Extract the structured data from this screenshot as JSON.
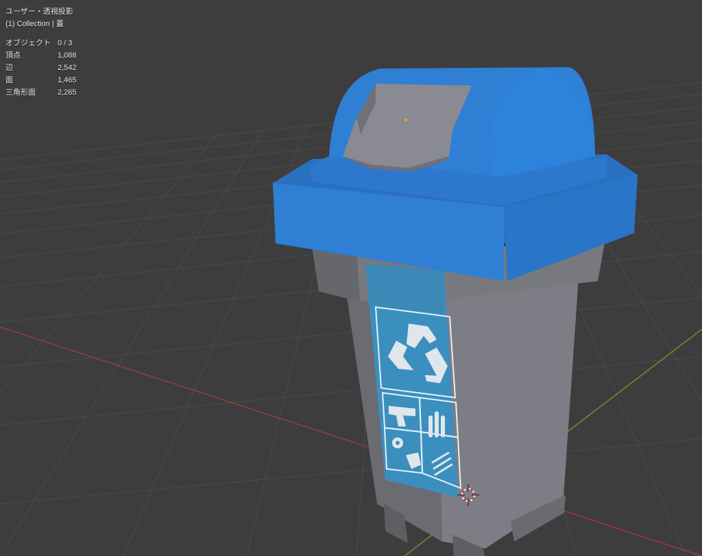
{
  "viewport": {
    "view_label": "ユーザー・透視投影",
    "collection_label": "(1) Collection | 蓋"
  },
  "stats": [
    {
      "label": "オブジェクト",
      "value": "0 / 3"
    },
    {
      "label": "頂点",
      "value": "1,088"
    },
    {
      "label": "辺",
      "value": "2,542"
    },
    {
      "label": "面",
      "value": "1,465"
    },
    {
      "label": "三角形面",
      "value": "2,265"
    }
  ],
  "colors": {
    "background": "#3d3d3d",
    "grid": "#4a4a4a",
    "axis_x": "#a83a3a",
    "axis_y": "#6f9a2c",
    "lid": "#2f7fd4",
    "body": "#7a7a82",
    "sticker": "#3b8fbf"
  },
  "icons": [
    "recycle-icon",
    "pistol-icon",
    "ammo-icon",
    "gear-icon",
    "bandage-icon",
    "cloth-icon",
    "origin-dot-icon",
    "3d-cursor-icon"
  ]
}
